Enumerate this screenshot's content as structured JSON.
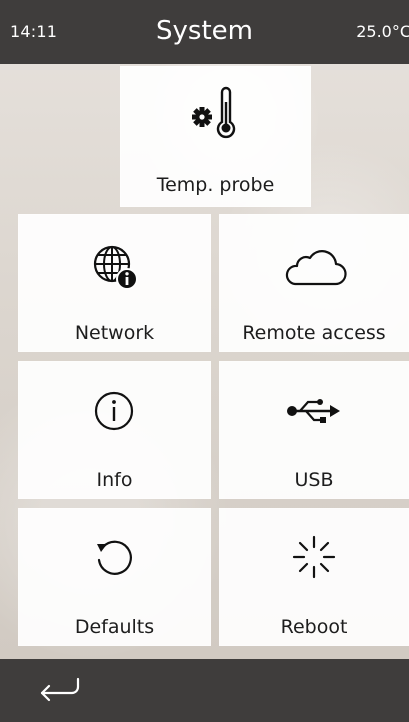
{
  "status_bar": {
    "time": "14:11",
    "title": "System",
    "temperature": "25.0°C"
  },
  "tiles": {
    "temp_probe": {
      "label": "Temp. probe",
      "icon": "gear-thermometer-icon"
    },
    "network": {
      "label": "Network",
      "icon": "globe-info-icon"
    },
    "remote_access": {
      "label": "Remote access",
      "icon": "cloud-icon"
    },
    "info": {
      "label": "Info",
      "icon": "info-circle-icon"
    },
    "usb": {
      "label": "USB",
      "icon": "usb-icon"
    },
    "defaults": {
      "label": "Defaults",
      "icon": "reset-icon"
    },
    "reboot": {
      "label": "Reboot",
      "icon": "reboot-spinner-icon"
    }
  },
  "bottom_bar": {
    "back_icon": "back-arrow-icon"
  },
  "colors": {
    "bar": "#3f3d3c",
    "tile": "#ffffff",
    "text": "#1d1d1d"
  }
}
